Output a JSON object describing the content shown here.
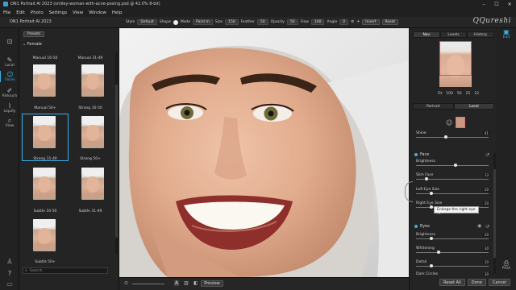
{
  "window": {
    "title": "ON1 Portrait AI 2023 (smiley-woman-with-acne-posing.psd @ 42.0% 8-bit)",
    "minimize": "–",
    "maximize": "☐",
    "close": "✕"
  },
  "menu": [
    "File",
    "Edit",
    "Photo",
    "Settings",
    "View",
    "Window",
    "Help"
  ],
  "toolbar": {
    "app_label": "ON1 Portrait AI 2023",
    "style_label": "Style",
    "style_value": "Default",
    "shape_label": "Shape",
    "mode_label": "Mode",
    "mode_value": "Paint In",
    "size_label": "Size",
    "size_value": "150",
    "feather_label": "Feather",
    "feather_value": "50",
    "opacity_label": "Opacity",
    "opacity_value": "50",
    "flow_label": "Flow",
    "flow_value": "100",
    "angle_label": "Angle",
    "angle_value": "0",
    "invert_label": "Invert",
    "reset_label": "Reset",
    "brand": "QQureshi"
  },
  "left_tools": [
    {
      "label": "",
      "icon": "crop-icon"
    },
    {
      "label": "Local",
      "icon": "local-icon"
    },
    {
      "label": "Faces",
      "icon": "faces-icon",
      "active": true
    },
    {
      "label": "Retouch",
      "icon": "retouch-icon"
    },
    {
      "label": "Liquify",
      "icon": "liquify-icon"
    },
    {
      "label": "View",
      "icon": "view-icon"
    }
  ],
  "browser": {
    "presets_label": "Presets",
    "folder": "Female",
    "items": [
      {
        "label": "Manual 16-50"
      },
      {
        "label": "Manual 31-49"
      },
      {
        "label": "Manual 50+"
      },
      {
        "label": "Strong 16-50"
      },
      {
        "label": "Strong 31-49",
        "selected": true
      },
      {
        "label": "Strong 50+"
      },
      {
        "label": "Subtle 16-50"
      },
      {
        "label": "Subtle 31-49"
      },
      {
        "label": "Subtle 50+"
      }
    ],
    "search_placeholder": "Search"
  },
  "bottom": {
    "preview_label": "Preview",
    "reset_all": "Reset All",
    "done": "Done",
    "cancel": "Cancel"
  },
  "right_panel": {
    "tabs": [
      "Nav",
      "Levels",
      "History"
    ],
    "zoom_levels": [
      "Fit",
      "100",
      "50",
      "25",
      "12"
    ],
    "mode_tabs": [
      "Portrait",
      "Local"
    ],
    "shine": {
      "label": "Shine",
      "value": "41",
      "fraction": 0.41
    },
    "face": {
      "title": "Face",
      "brightness": {
        "label": "Brightness",
        "value": "",
        "fraction": 0.55
      },
      "slim_face": {
        "label": "Slim Face",
        "value": "13",
        "fraction": 0.13
      },
      "left_eye": {
        "label": "Left Eye Size",
        "value": "20",
        "fraction": 0.2
      },
      "right_eye": {
        "label": "Right Eye Size",
        "value": "20",
        "fraction": 0.2
      }
    },
    "eyes": {
      "title": "Eyes",
      "brightness": {
        "label": "Brightness",
        "value": "20",
        "fraction": 0.2
      },
      "whitening": {
        "label": "Whitening",
        "value": "30",
        "fraction": 0.3
      },
      "detail": {
        "label": "Detail",
        "value": "20",
        "fraction": 0.2
      },
      "dark_circles": {
        "label": "Dark Circles",
        "value": "30",
        "fraction": 0.3
      }
    },
    "tooltip": "Enlarge the right eye"
  },
  "right_tools": [
    {
      "label": "Edit",
      "icon": "edit-icon",
      "active": true
    },
    {
      "label": "Print",
      "icon": "print-icon"
    }
  ]
}
